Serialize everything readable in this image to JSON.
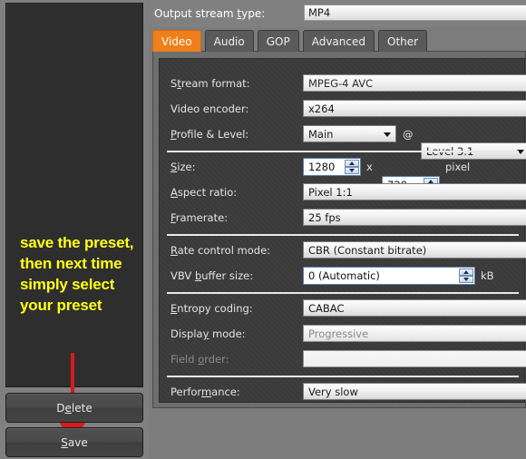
{
  "sidebar": {
    "annotation": "save the preset, then next time simply select your preset",
    "delete_button": {
      "pre": "D",
      "acc": "e",
      "post": "lete"
    },
    "save_button": {
      "pre": "",
      "acc": "S",
      "post": "ave"
    }
  },
  "header": {
    "output_stream_label": {
      "pre": "Output stream ",
      "acc": "t",
      "post": "ype:"
    },
    "output_stream_value": "MP4"
  },
  "tabs": [
    {
      "label": "Video",
      "active": true
    },
    {
      "label": "Audio",
      "active": false
    },
    {
      "label": "GOP",
      "active": false
    },
    {
      "label": "Advanced",
      "active": false
    },
    {
      "label": "Other",
      "active": false
    }
  ],
  "form": {
    "stream_format": {
      "label": {
        "pre": "S",
        "acc": "t",
        "post": "ream format:"
      },
      "value": "MPEG-4 AVC"
    },
    "video_encoder": {
      "label": {
        "pre": "Video encoder:",
        "acc": "",
        "post": ""
      },
      "value": "x264"
    },
    "profile_level": {
      "label": {
        "pre": "",
        "acc": "P",
        "post": "rofile & Level:"
      },
      "profile": "Main",
      "separator": "@",
      "level": "Level 3.1"
    },
    "size": {
      "label": {
        "pre": "",
        "acc": "S",
        "post": "ize:"
      },
      "width": "1280",
      "times": "x",
      "height": "720",
      "unit": "pixel"
    },
    "aspect_ratio": {
      "label": {
        "pre": "",
        "acc": "A",
        "post": "spect ratio:"
      },
      "value": "Pixel 1:1"
    },
    "framerate": {
      "label": {
        "pre": "",
        "acc": "F",
        "post": "ramerate:"
      },
      "value": "25 fps"
    },
    "rate_control": {
      "label": {
        "pre": "",
        "acc": "R",
        "post": "ate control mode:"
      },
      "value": "CBR (Constant bitrate)"
    },
    "vbv_buffer": {
      "label": {
        "pre": "VBV ",
        "acc": "b",
        "post": "uffer size:"
      },
      "value": "0 (Automatic)",
      "unit": "kB"
    },
    "entropy_coding": {
      "label": {
        "pre": "",
        "acc": "E",
        "post": "ntropy coding:"
      },
      "value": "CABAC"
    },
    "display_mode": {
      "label": {
        "pre": "Displa",
        "acc": "y",
        "post": " mode:"
      },
      "value": "Progressive"
    },
    "field_order": {
      "label": {
        "pre": "Field ",
        "acc": "o",
        "post": "rder:"
      },
      "value": "",
      "disabled": true
    },
    "performance": {
      "label": {
        "pre": "Perfor",
        "acc": "m",
        "post": "ance:"
      },
      "value": "Very slow"
    }
  },
  "colors": {
    "accent_orange": "#ef7f1a",
    "annotation_yellow": "#ffff1a",
    "arrow_red": "#d71a1a"
  }
}
